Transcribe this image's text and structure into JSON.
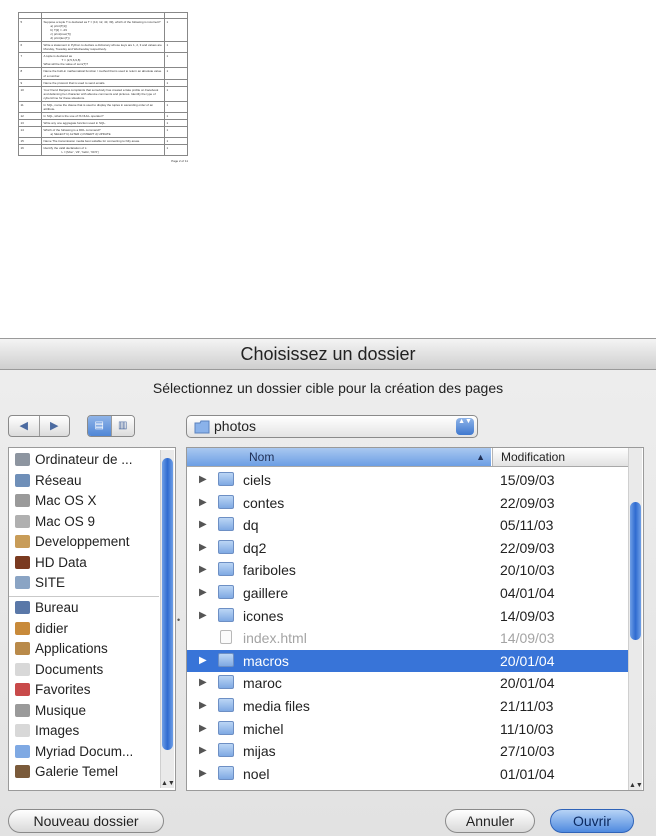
{
  "document": {
    "questions": [
      {
        "num": "5",
        "lines": [
          "Suppose a tuple T is declared as T = (10, 12, 43, 39), which of the following is incorrect?"
        ],
        "sub": [
          "a) print(T[1])",
          "b) T[2] = -29",
          "c) print(max(T))",
          "d) print(len(T))"
        ],
        "marks": "1"
      },
      {
        "num": "6",
        "lines": [
          "Write a statement in Python to declare a dictionary whose keys are 1, 2, 3 and values are Monday, Tuesday and Wednesday respectively."
        ],
        "sub": [],
        "marks": "1"
      },
      {
        "num": "7",
        "lines": [
          "A tuple is declared as"
        ],
        "sub": [
          "T = (2,5,6,9,8)"
        ],
        "extra": "What will be the value of sum(T)?",
        "marks": "1"
      },
      {
        "num": "8",
        "lines": [
          "Name the built-in mathematical function / method that is used to return an absolute value of a number."
        ],
        "sub": [],
        "marks": "1"
      },
      {
        "num": "9",
        "lines": [
          "Name the protocol that is used to send emails."
        ],
        "sub": [],
        "marks": "1"
      },
      {
        "num": "10",
        "lines": [
          "Your friend Ranjana complaints that somebody has created a fake profile on Facebook and defaming her character with abusive comments and pictures. Identify the type of cybercrime for these situations."
        ],
        "sub": [],
        "marks": "1"
      },
      {
        "num": "11",
        "lines": [
          "In SQL, name the clause that is used to display the tuples in ascending order of an attribute."
        ],
        "sub": [],
        "marks": "1"
      },
      {
        "num": "12",
        "lines": [
          "In SQL, what is the use of IS NULL operator?"
        ],
        "sub": [],
        "marks": "1"
      },
      {
        "num": "13",
        "lines": [
          "Write any one aggregate function used in SQL."
        ],
        "sub": [],
        "marks": "1"
      },
      {
        "num": "14",
        "lines": [
          "Which of the following is a DDL command?"
        ],
        "sub": [
          "a) SELECT    b) ALTER    c) INSERT    d) UPDATE"
        ],
        "marks": "1"
      },
      {
        "num": "15",
        "lines": [
          "Name  The transmission media best suitable for connecting to hilly areas."
        ],
        "sub": [],
        "marks": "1"
      },
      {
        "num": "16",
        "lines": [
          "Identify the valid declaration of L:"
        ],
        "sub": [
          "L = [Mon', '23', 'hello', '60.5']"
        ],
        "marks": "1"
      }
    ],
    "page_number": "Page 2 of 11"
  },
  "dialog": {
    "title": "Choisissez un dossier",
    "subtitle": "Sélectionnez un dossier cible pour la création des pages",
    "back_glyph": "◀",
    "forward_glyph": "▶",
    "view_list_glyph": "▤",
    "view_column_glyph": "▥",
    "folder_popup": "photos",
    "popup_arrows": "▲▼",
    "sidebar": {
      "devices": [
        {
          "label": "Ordinateur de ...",
          "icon": "computer-icon",
          "color": "#8d95a0"
        },
        {
          "label": "Réseau",
          "icon": "network-icon",
          "color": "#6f8fb8"
        },
        {
          "label": "Mac OS X",
          "icon": "hard-drive-icon",
          "color": "#9a9a9a"
        },
        {
          "label": "Mac OS 9",
          "icon": "hard-drive-icon",
          "color": "#b0b0b0"
        },
        {
          "label": "Developpement",
          "icon": "external-drive-icon",
          "color": "#c89c58"
        },
        {
          "label": "HD Data",
          "icon": "hard-drive-icon",
          "color": "#7a3a20"
        },
        {
          "label": "SITE",
          "icon": "network-volume-icon",
          "color": "#8aa4c4"
        }
      ],
      "places": [
        {
          "label": "Bureau",
          "icon": "desktop-icon",
          "color": "#5a78a8"
        },
        {
          "label": "didier",
          "icon": "home-icon",
          "color": "#c88a3a"
        },
        {
          "label": "Applications",
          "icon": "applications-icon",
          "color": "#b98a4a"
        },
        {
          "label": "Documents",
          "icon": "documents-icon",
          "color": "#d8d8d8"
        },
        {
          "label": "Favorites",
          "icon": "favorites-icon",
          "color": "#c84a4a"
        },
        {
          "label": "Musique",
          "icon": "music-icon",
          "color": "#9a9a9a"
        },
        {
          "label": "Images",
          "icon": "pictures-icon",
          "color": "#d8d8d8"
        },
        {
          "label": "Myriad Docum...",
          "icon": "folder-icon",
          "color": "#7fa9e3"
        },
        {
          "label": "Galerie Temel",
          "icon": "folder-icon",
          "color": "#7a5a3a"
        }
      ]
    },
    "columns": {
      "name": "Nom",
      "sort_glyph": "▲",
      "date": "Modification"
    },
    "files": [
      {
        "name": "ciels",
        "date": "15/09/03",
        "type": "folder",
        "state": ""
      },
      {
        "name": "contes",
        "date": "22/09/03",
        "type": "folder",
        "state": ""
      },
      {
        "name": "dq",
        "date": "05/11/03",
        "type": "folder",
        "state": ""
      },
      {
        "name": "dq2",
        "date": "22/09/03",
        "type": "folder",
        "state": ""
      },
      {
        "name": "fariboles",
        "date": "20/10/03",
        "type": "folder",
        "state": ""
      },
      {
        "name": "gaillere",
        "date": "04/01/04",
        "type": "folder",
        "state": ""
      },
      {
        "name": "icones",
        "date": "14/09/03",
        "type": "folder",
        "state": ""
      },
      {
        "name": "index.html",
        "date": "14/09/03",
        "type": "file",
        "state": "dim"
      },
      {
        "name": "macros",
        "date": "20/01/04",
        "type": "folder",
        "state": "sel"
      },
      {
        "name": "maroc",
        "date": "20/01/04",
        "type": "folder",
        "state": ""
      },
      {
        "name": "media files",
        "date": "21/11/03",
        "type": "folder",
        "state": ""
      },
      {
        "name": "michel",
        "date": "11/10/03",
        "type": "folder",
        "state": ""
      },
      {
        "name": "mijas",
        "date": "27/10/03",
        "type": "folder",
        "state": ""
      },
      {
        "name": "noel",
        "date": "01/01/04",
        "type": "folder",
        "state": ""
      }
    ],
    "disclosure_glyph": "▶",
    "scroll_arrows": "▲▼",
    "splitter_glyph": "•",
    "buttons": {
      "new_folder": "Nouveau dossier",
      "cancel": "Annuler",
      "open": "Ouvrir"
    },
    "colors": {
      "selection": "#3874d8",
      "accent": "#2f6bd0"
    }
  }
}
